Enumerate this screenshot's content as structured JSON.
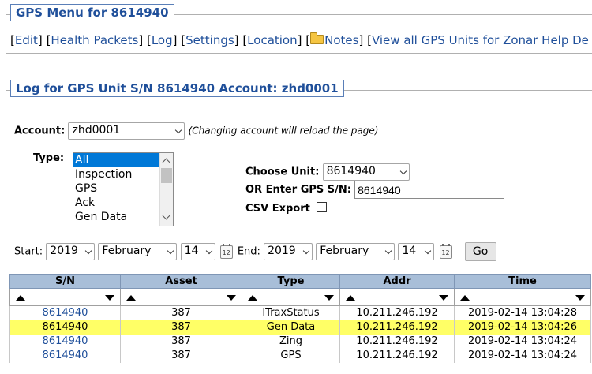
{
  "menu": {
    "title": "GPS Menu for 8614940",
    "links": [
      "Edit",
      "Health Packets",
      "Log",
      "Settings",
      "Location",
      "Notes",
      "View all GPS Units for Zonar Help De"
    ]
  },
  "log": {
    "title": "Log for GPS Unit S/N 8614940 Account: zhd0001",
    "account_label": "Account:",
    "account_value": "zhd0001",
    "account_note": "(Changing account will reload the page)",
    "type_label": "Type:",
    "type_options": [
      "All",
      "Inspection",
      "GPS",
      "Ack",
      "Gen Data"
    ],
    "type_selected": "All",
    "choose_unit_label": "Choose Unit:",
    "choose_unit_value": "8614940",
    "enter_sn_label": "OR Enter GPS S/N:",
    "enter_sn_value": "8614940",
    "csv_label": "CSV Export",
    "start_label": "Start:",
    "start_year": "2019",
    "start_month": "February",
    "start_day": "14",
    "end_label": "End:",
    "end_year": "2019",
    "end_month": "February",
    "end_day": "14",
    "go_label": "Go",
    "calendar_icon_text": "12"
  },
  "table": {
    "columns": [
      "S/N",
      "Asset",
      "Type",
      "Addr",
      "Time"
    ],
    "rows": [
      {
        "sn": "8614940",
        "asset": "387",
        "type": "ITraxStatus",
        "addr": "10.211.246.192",
        "time": "2019-02-14 13:04:28",
        "highlighted": false
      },
      {
        "sn": "8614940",
        "asset": "387",
        "type": "Gen Data",
        "addr": "10.211.246.192",
        "time": "2019-02-14 13:04:26",
        "highlighted": true
      },
      {
        "sn": "8614940",
        "asset": "387",
        "type": "Zing",
        "addr": "10.211.246.192",
        "time": "2019-02-14 13:04:24",
        "highlighted": false
      },
      {
        "sn": "8614940",
        "asset": "387",
        "type": "GPS",
        "addr": "10.211.246.192",
        "time": "2019-02-14 13:04:24",
        "highlighted": false
      }
    ]
  },
  "colors": {
    "accent": "#1f4f9a",
    "header_bg": "#a8bed8",
    "highlight_row": "#ffff66",
    "list_selected": "#0078d7"
  },
  "icons": {
    "notes": "folder-icon",
    "calendar": "calendar-icon",
    "sort_asc": "sort-up-icon",
    "sort_desc": "sort-down-icon"
  }
}
